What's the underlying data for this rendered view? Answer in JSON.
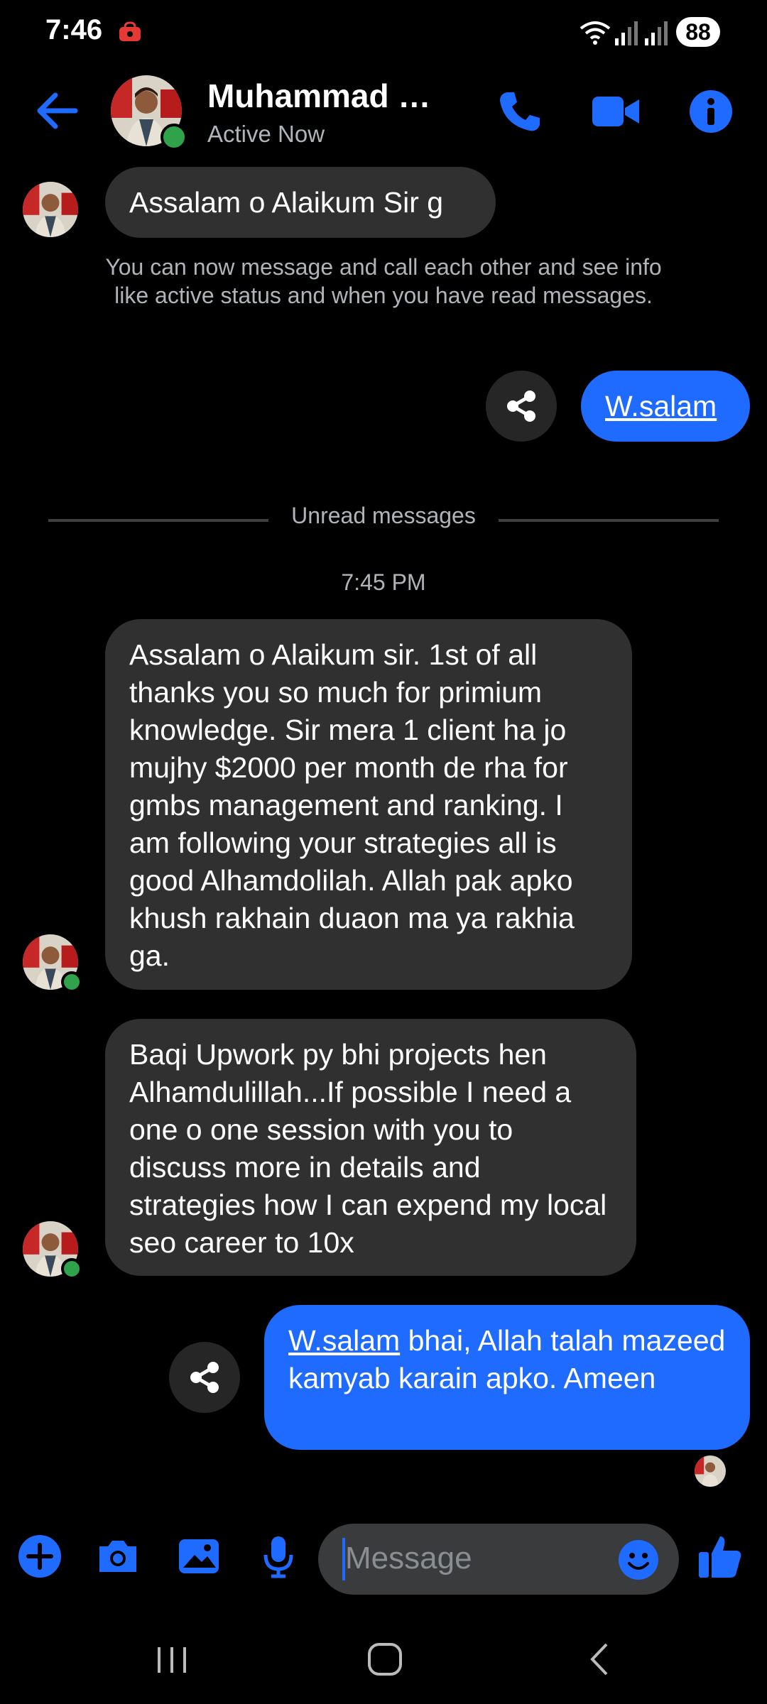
{
  "status_bar": {
    "time": "7:46",
    "battery": "88"
  },
  "header": {
    "contact_name": "Muhammad Us...",
    "status": "Active Now"
  },
  "messages": {
    "m1": "Assalam o Alaikum Sir g",
    "system_note": "You can now message and call each other and see info like active status and when you have read messages.",
    "m2": "W.salam",
    "unread_label": "Unread messages",
    "timestamp": "7:45 PM",
    "m3": "Assalam o Alaikum sir. 1st of all thanks you so much for primium knowledge. Sir mera 1 client ha jo mujhy $2000 per month de rha for gmbs management and ranking. I am following your strategies all is good Alhamdolilah. Allah pak apko khush rakhain duaon ma ya rakhia ga.",
    "m4": "Baqi Upwork py bhi projects hen Alhamdulillah...If possible I need a one o one session with you to discuss more in details and strategies how I can expend my local seo career to 10x",
    "m5_link": "W.salam",
    "m5_rest": " bhai, Allah talah mazeed kamyab karain apko. Ameen"
  },
  "composer": {
    "placeholder": "Message"
  },
  "colors": {
    "accent": "#1f6bff",
    "incoming_bubble": "#303030",
    "online": "#31a24c"
  },
  "icons": [
    "back-arrow-icon",
    "phone-icon",
    "video-icon",
    "info-icon",
    "share-icon",
    "plus-icon",
    "camera-icon",
    "gallery-icon",
    "mic-icon",
    "emoji-icon",
    "like-icon"
  ]
}
